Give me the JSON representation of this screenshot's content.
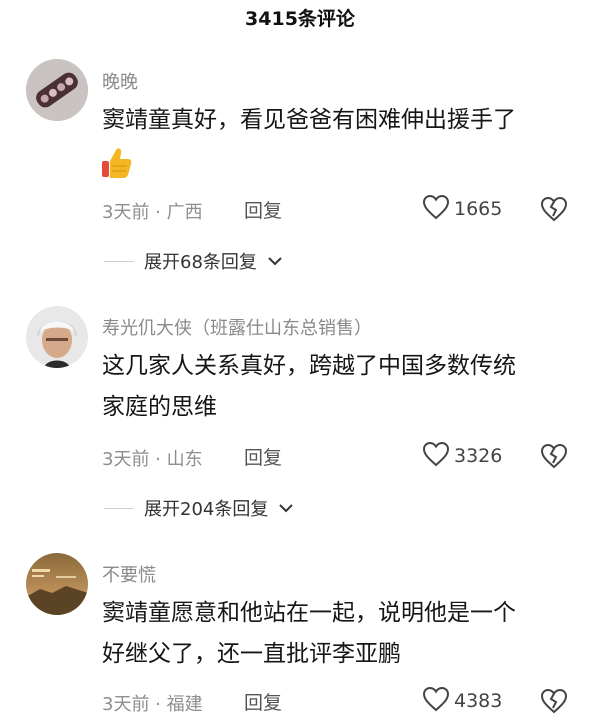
{
  "header": {
    "title": "3415条评论"
  },
  "comments": [
    {
      "username": "晚晚",
      "lines": [
        "窦靖童真好，看见爸爸有困难伸出援手了"
      ],
      "emoji": "thumbs-up",
      "time_location": "3天前 · 广西",
      "reply_label": "回复",
      "likes": "1665",
      "expand_label": "展开68条回复"
    },
    {
      "username": "寿光仉大侠（班露仕山东总销售）",
      "lines": [
        "这几家人关系真好，跨越了中国多数传统",
        "家庭的思维"
      ],
      "time_location": "3天前 · 山东",
      "reply_label": "回复",
      "likes": "3326",
      "expand_label": "展开204条回复"
    },
    {
      "username": "不要慌",
      "lines": [
        "窦靖童愿意和他站在一起，说明他是一个",
        "好继父了，还一直批评李亚鹏"
      ],
      "time_location": "3天前 · 福建",
      "reply_label": "回复",
      "likes": "4383"
    }
  ],
  "icons": {
    "like": "heart-outline-icon",
    "dislike": "broken-heart-icon",
    "expand": "chevron-down-icon"
  }
}
